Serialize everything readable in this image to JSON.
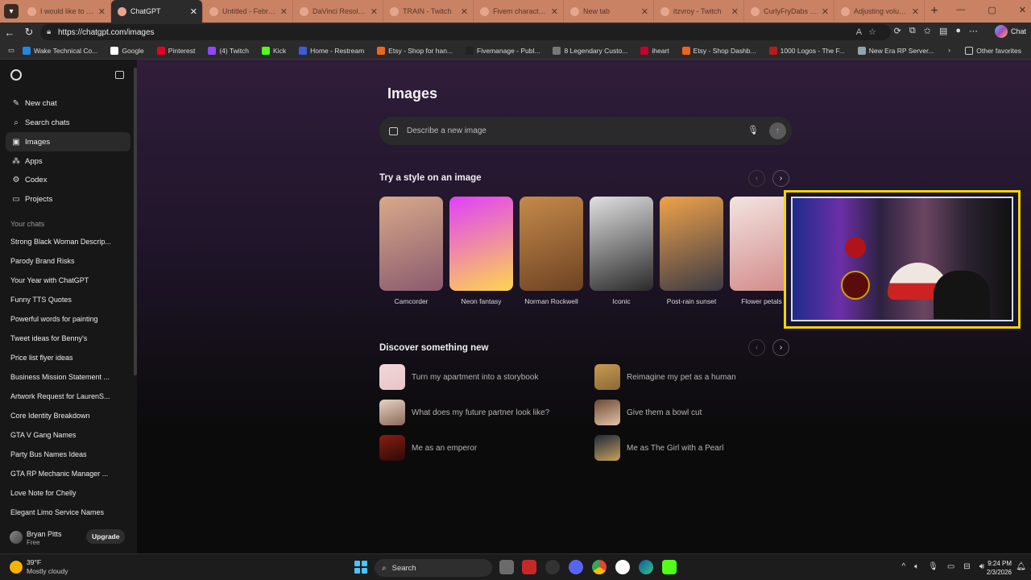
{
  "browser": {
    "tabs": [
      {
        "title": "I would like to make",
        "active": false
      },
      {
        "title": "ChatGPT",
        "active": true
      },
      {
        "title": "Untitled - February D",
        "active": false
      },
      {
        "title": "DaVinci Resolve free",
        "active": false
      },
      {
        "title": "TRAIN - Twitch",
        "active": false
      },
      {
        "title": "Fivem character nam",
        "active": false
      },
      {
        "title": "New tab",
        "active": false
      },
      {
        "title": "itzvroy - Twitch",
        "active": false
      },
      {
        "title": "CurlyFryDabs Stream",
        "active": false
      },
      {
        "title": "Adjusting volume fo",
        "active": false
      }
    ],
    "url": "https://chatgpt.com/images",
    "copilot_label": "Chat",
    "bookmarks": [
      {
        "label": "Wake Technical Co...",
        "color": "#1e88e5"
      },
      {
        "label": "Google",
        "color": "#ffffff"
      },
      {
        "label": "Pinterest",
        "color": "#e60023"
      },
      {
        "label": "(4) Twitch",
        "color": "#9146ff"
      },
      {
        "label": "Kick",
        "color": "#53fc18"
      },
      {
        "label": "Home - Restream",
        "color": "#3b5bdb"
      },
      {
        "label": "Etsy - Shop for han...",
        "color": "#f1641e"
      },
      {
        "label": "Fivemanage - Publ...",
        "color": "#222222"
      },
      {
        "label": "8 Legendary Custo...",
        "color": "#777777"
      },
      {
        "label": "iheart",
        "color": "#c6002b"
      },
      {
        "label": "Etsy - Shop Dashb...",
        "color": "#f1641e"
      },
      {
        "label": "1000 Logos - The F...",
        "color": "#b71c1c"
      },
      {
        "label": "New Era RP Server...",
        "color": "#90a4ae"
      }
    ],
    "other_favorites": "Other favorites"
  },
  "sidebar": {
    "nav": [
      {
        "label": "New chat",
        "icon": "edit-icon",
        "glyph": "✎"
      },
      {
        "label": "Search chats",
        "icon": "search-icon",
        "glyph": "⌕"
      },
      {
        "label": "Images",
        "icon": "image-icon",
        "glyph": "▣"
      },
      {
        "label": "Apps",
        "icon": "apps-icon",
        "glyph": "⁂"
      },
      {
        "label": "Codex",
        "icon": "codex-icon",
        "glyph": "⚙"
      },
      {
        "label": "Projects",
        "icon": "folder-icon",
        "glyph": "▭"
      }
    ],
    "your_chats_label": "Your chats",
    "chats": [
      "Strong Black Woman Descrip...",
      "Parody Brand Risks",
      "Your Year with ChatGPT",
      "Funny TTS Quotes",
      "Powerful words for painting",
      "Tweet ideas for Benny's",
      "Price list flyer ideas",
      "Business Mission Statement ...",
      "Artwork Request for LaurenS...",
      "Core Identity Breakdown",
      "GTA V Gang Names",
      "Party Bus Names Ideas",
      "GTA RP Mechanic Manager ...",
      "Love Note for Chelly",
      "Elegant Limo Service Names"
    ],
    "user": {
      "name": "Bryan Pitts",
      "plan": "Free",
      "upgrade_label": "Upgrade"
    }
  },
  "main": {
    "title": "Images",
    "prompt_placeholder": "Describe a new image",
    "styles_heading": "Try a style on an image",
    "styles": [
      {
        "label": "Camcorder",
        "colors": [
          "#d8a98a",
          "#8a5a6e"
        ]
      },
      {
        "label": "Neon fantasy",
        "colors": [
          "#e040fb",
          "#ffd54f"
        ]
      },
      {
        "label": "Norman Rockwell",
        "colors": [
          "#c58a4a",
          "#6d4223"
        ]
      },
      {
        "label": "Iconic",
        "colors": [
          "#e0e0e0",
          "#2a2a2a"
        ]
      },
      {
        "label": "Post-rain sunset",
        "colors": [
          "#f0a24a",
          "#3c3a44"
        ]
      },
      {
        "label": "Flower petals",
        "colors": [
          "#f3e4e0",
          "#d28a8a"
        ]
      }
    ],
    "discover_heading": "Discover something new",
    "discover": [
      {
        "label": "Turn my apartment into a storybook",
        "colors": [
          "#f2d8d8",
          "#e7c4c8"
        ]
      },
      {
        "label": "Reimagine my pet as a human",
        "colors": [
          "#c89a4e",
          "#8a6a3a"
        ]
      },
      {
        "label": "What does my future partner look like?",
        "colors": [
          "#e9d3c4",
          "#8a6a5a"
        ]
      },
      {
        "label": "Give them a bowl cut",
        "colors": [
          "#6b4a34",
          "#e5c3a8"
        ]
      },
      {
        "label": "Me as an emperor",
        "colors": [
          "#8a1e12",
          "#2a0a08"
        ]
      },
      {
        "label": "Me as The Girl with a Pearl",
        "colors": [
          "#1d2a3a",
          "#c8a05a"
        ]
      }
    ]
  },
  "taskbar": {
    "weather_temp": "39°F",
    "weather_desc": "Mostly cloudy",
    "search_label": "Search",
    "time": "9:24 PM",
    "date": "2/3/2026"
  }
}
